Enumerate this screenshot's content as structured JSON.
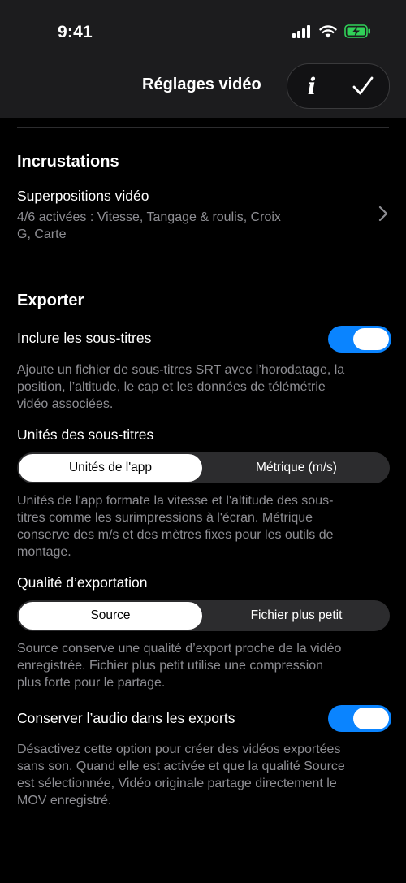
{
  "status_bar": {
    "time": "9:41"
  },
  "nav": {
    "title": "Réglages vidéo"
  },
  "overlays": {
    "section_title": "Incrustations",
    "row_title": "Superpositions vidéo",
    "row_detail_line1": "4/6 activées : Vitesse, Tangage & roulis, Croix",
    "row_detail_line2": "G, Carte"
  },
  "export": {
    "section_title": "Exporter",
    "subtitles_toggle": {
      "label": "Inclure les sous-titres",
      "on": true,
      "desc_line1": "Ajoute un fichier de sous-titres SRT avec l’horodatage, la",
      "desc_line2": "position, l’altitude, le cap et les données de télémétrie",
      "desc_line3": "vidéo associées."
    },
    "units": {
      "label": "Unités des sous-titres",
      "options": [
        "Unités de l'app",
        "Métrique (m/s)"
      ],
      "selected": "Unités de l'app",
      "desc_line1": "Unités de l'app formate la vitesse et l'altitude des sous-",
      "desc_line2": "titres comme les surimpressions à l'écran. Métrique",
      "desc_line3": "conserve des m/s et des mètres fixes pour les outils de",
      "desc_line4": "montage."
    },
    "quality": {
      "label": "Qualité d’exportation",
      "options": [
        "Source",
        "Fichier plus petit"
      ],
      "selected": "Source",
      "desc_line1": "Source conserve une qualité d’export proche de la vidéo",
      "desc_line2": "enregistrée. Fichier plus petit utilise une compression",
      "desc_line3": "plus forte pour le partage."
    },
    "audio_toggle": {
      "label": "Conserver l’audio dans les exports",
      "on": true,
      "desc_line1": "Désactivez cette option pour créer des vidéos exportées",
      "desc_line2": "sans son. Quand elle est activée et que la qualité Source",
      "desc_line3": "est sélectionnée, Vidéo originale partage directement le",
      "desc_line4": "MOV enregistré."
    }
  },
  "colors": {
    "accent": "#0a84ff",
    "background": "#000000",
    "secondary_text": "#8e8e93",
    "battery": "#30d158"
  }
}
